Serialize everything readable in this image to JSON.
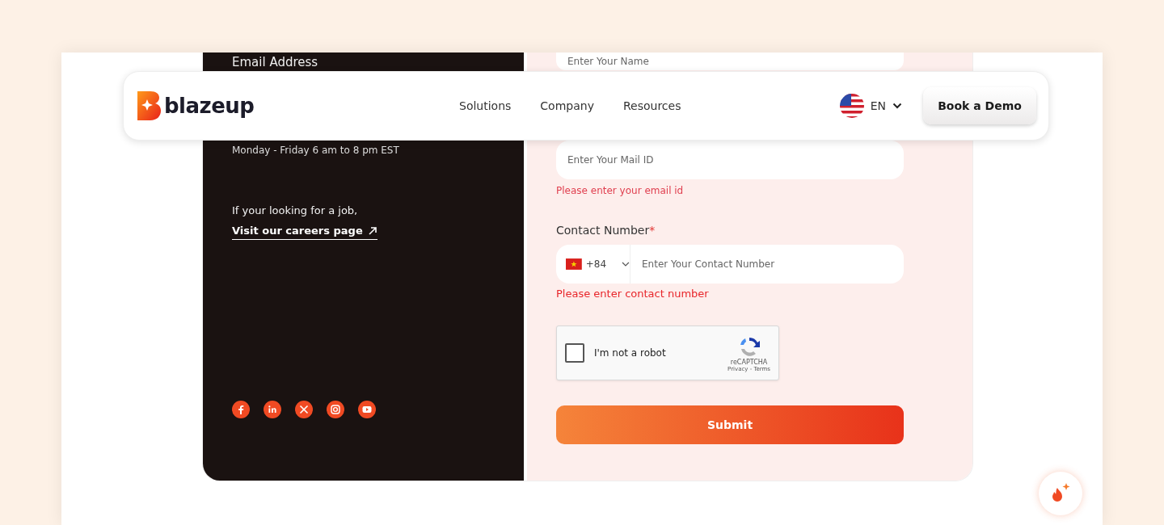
{
  "brand": {
    "name": "blazeup"
  },
  "nav": {
    "links": [
      "Solutions",
      "Company",
      "Resources"
    ],
    "language": "EN",
    "cta": "Book a Demo"
  },
  "contact_panel": {
    "email_label": "Email Address",
    "hours": "Monday - Friday 6 am to 8 pm EST",
    "job_text": "If your looking for a job,",
    "careers_link": "Visit our careers page",
    "socials": [
      {
        "kind": "facebook"
      },
      {
        "kind": "linkedin"
      },
      {
        "kind": "x"
      },
      {
        "kind": "instagram"
      },
      {
        "kind": "youtube"
      }
    ]
  },
  "form": {
    "name_field": {
      "placeholder": "Enter Your Name"
    },
    "email_field": {
      "placeholder": "Enter Your Mail ID"
    },
    "email_error": "Please enter your email id",
    "phone_label": "Contact Number",
    "required_mark": "*",
    "country_code": "+84",
    "phone_field": {
      "placeholder": "Enter Your Contact Number"
    },
    "phone_error": "Please enter contact number",
    "captcha": {
      "label": "I'm not a robot",
      "checked": false,
      "brand": "reCAPTCHA",
      "links": "Privacy - Terms"
    },
    "submit": "Submit"
  }
}
